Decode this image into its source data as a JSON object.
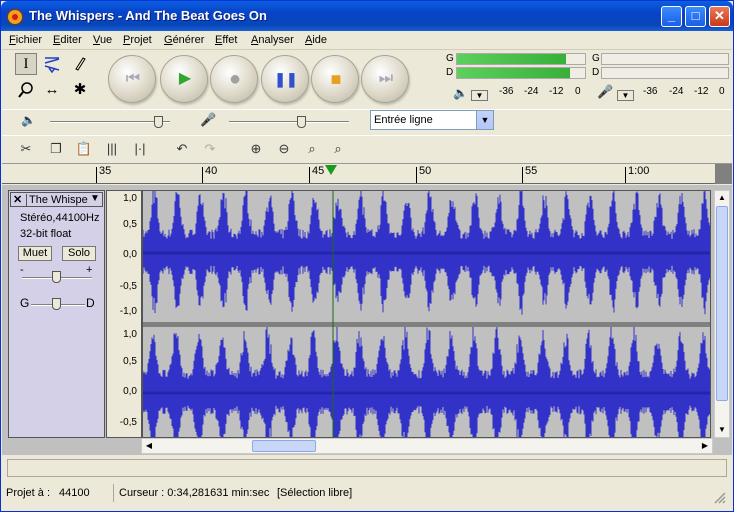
{
  "window": {
    "title": "The Whispers - And The Beat Goes On"
  },
  "menu": [
    "Fichier",
    "Editer",
    "Vue",
    "Projet",
    "Générer",
    "Effet",
    "Analyser",
    "Aide"
  ],
  "tools": {
    "selection": "I",
    "envelope": "envelope",
    "draw": "pencil",
    "zoom": "magnifier",
    "timeshift": "↔",
    "multi": "✱"
  },
  "transport": [
    "skip-start",
    "play",
    "record",
    "pause",
    "stop",
    "skip-end"
  ],
  "meters": {
    "output": {
      "left_letter": "G",
      "right_letter": "D",
      "left_level": 0.85,
      "right_level": 0.88,
      "scale": [
        "-36",
        "-24",
        "-12",
        "0"
      ]
    },
    "input": {
      "left_letter": "G",
      "right_letter": "D",
      "scale": [
        "-36",
        "-24",
        "-12",
        "0"
      ]
    }
  },
  "mixer": {
    "output_volume": 0.9,
    "input_volume": 0.6,
    "input_source": "Entrée ligne"
  },
  "ruler": {
    "labels": [
      "35",
      "40",
      "45",
      "50",
      "55",
      "1:00"
    ],
    "playhead": "45"
  },
  "track": {
    "name": "The Whispe",
    "format": "Stéréo,44100Hz",
    "bits": "32-bit float",
    "mute": "Muet",
    "solo": "Solo",
    "gain_minus": "-",
    "gain_plus": "+",
    "pan_left": "G",
    "pan_right": "D",
    "channel1_scale": [
      "1,0",
      "0,5",
      "0,0",
      "-0,5",
      "-1,0"
    ],
    "channel2_scale": [
      "1,0",
      "0,5",
      "0,0",
      "-0,5"
    ],
    "wave_color": "#3232c8"
  },
  "status": {
    "rate_label": "Projet à :",
    "rate": "44100",
    "cursor": "Curseur : 0:34,281631 min:sec",
    "selection": "[Sélection libre]"
  },
  "colors": {
    "titlebar": "#0842c8",
    "wave": "#3232c8",
    "meter": "#38b038",
    "playhead": "#1a9a1a"
  }
}
